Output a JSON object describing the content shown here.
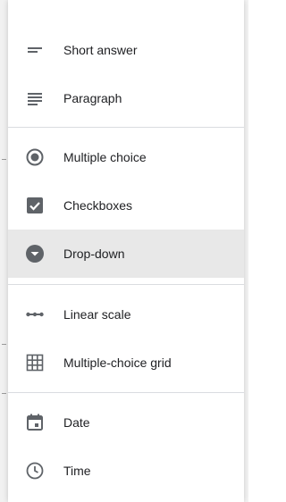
{
  "menu": {
    "items": [
      {
        "label": "Short answer",
        "icon": "short-text-icon"
      },
      {
        "label": "Paragraph",
        "icon": "paragraph-icon"
      },
      {
        "label": "Multiple choice",
        "icon": "radio-button-icon"
      },
      {
        "label": "Checkboxes",
        "icon": "checkbox-icon"
      },
      {
        "label": "Drop-down",
        "icon": "dropdown-circle-icon",
        "selected": true
      },
      {
        "label": "Linear scale",
        "icon": "linear-scale-icon"
      },
      {
        "label": "Multiple-choice grid",
        "icon": "grid-icon"
      },
      {
        "label": "Date",
        "icon": "calendar-icon"
      },
      {
        "label": "Time",
        "icon": "clock-icon"
      }
    ]
  },
  "colors": {
    "icon": "#5f6368",
    "text": "#202124",
    "selected_background": "#e8e8e8",
    "divider": "#dadce0"
  }
}
